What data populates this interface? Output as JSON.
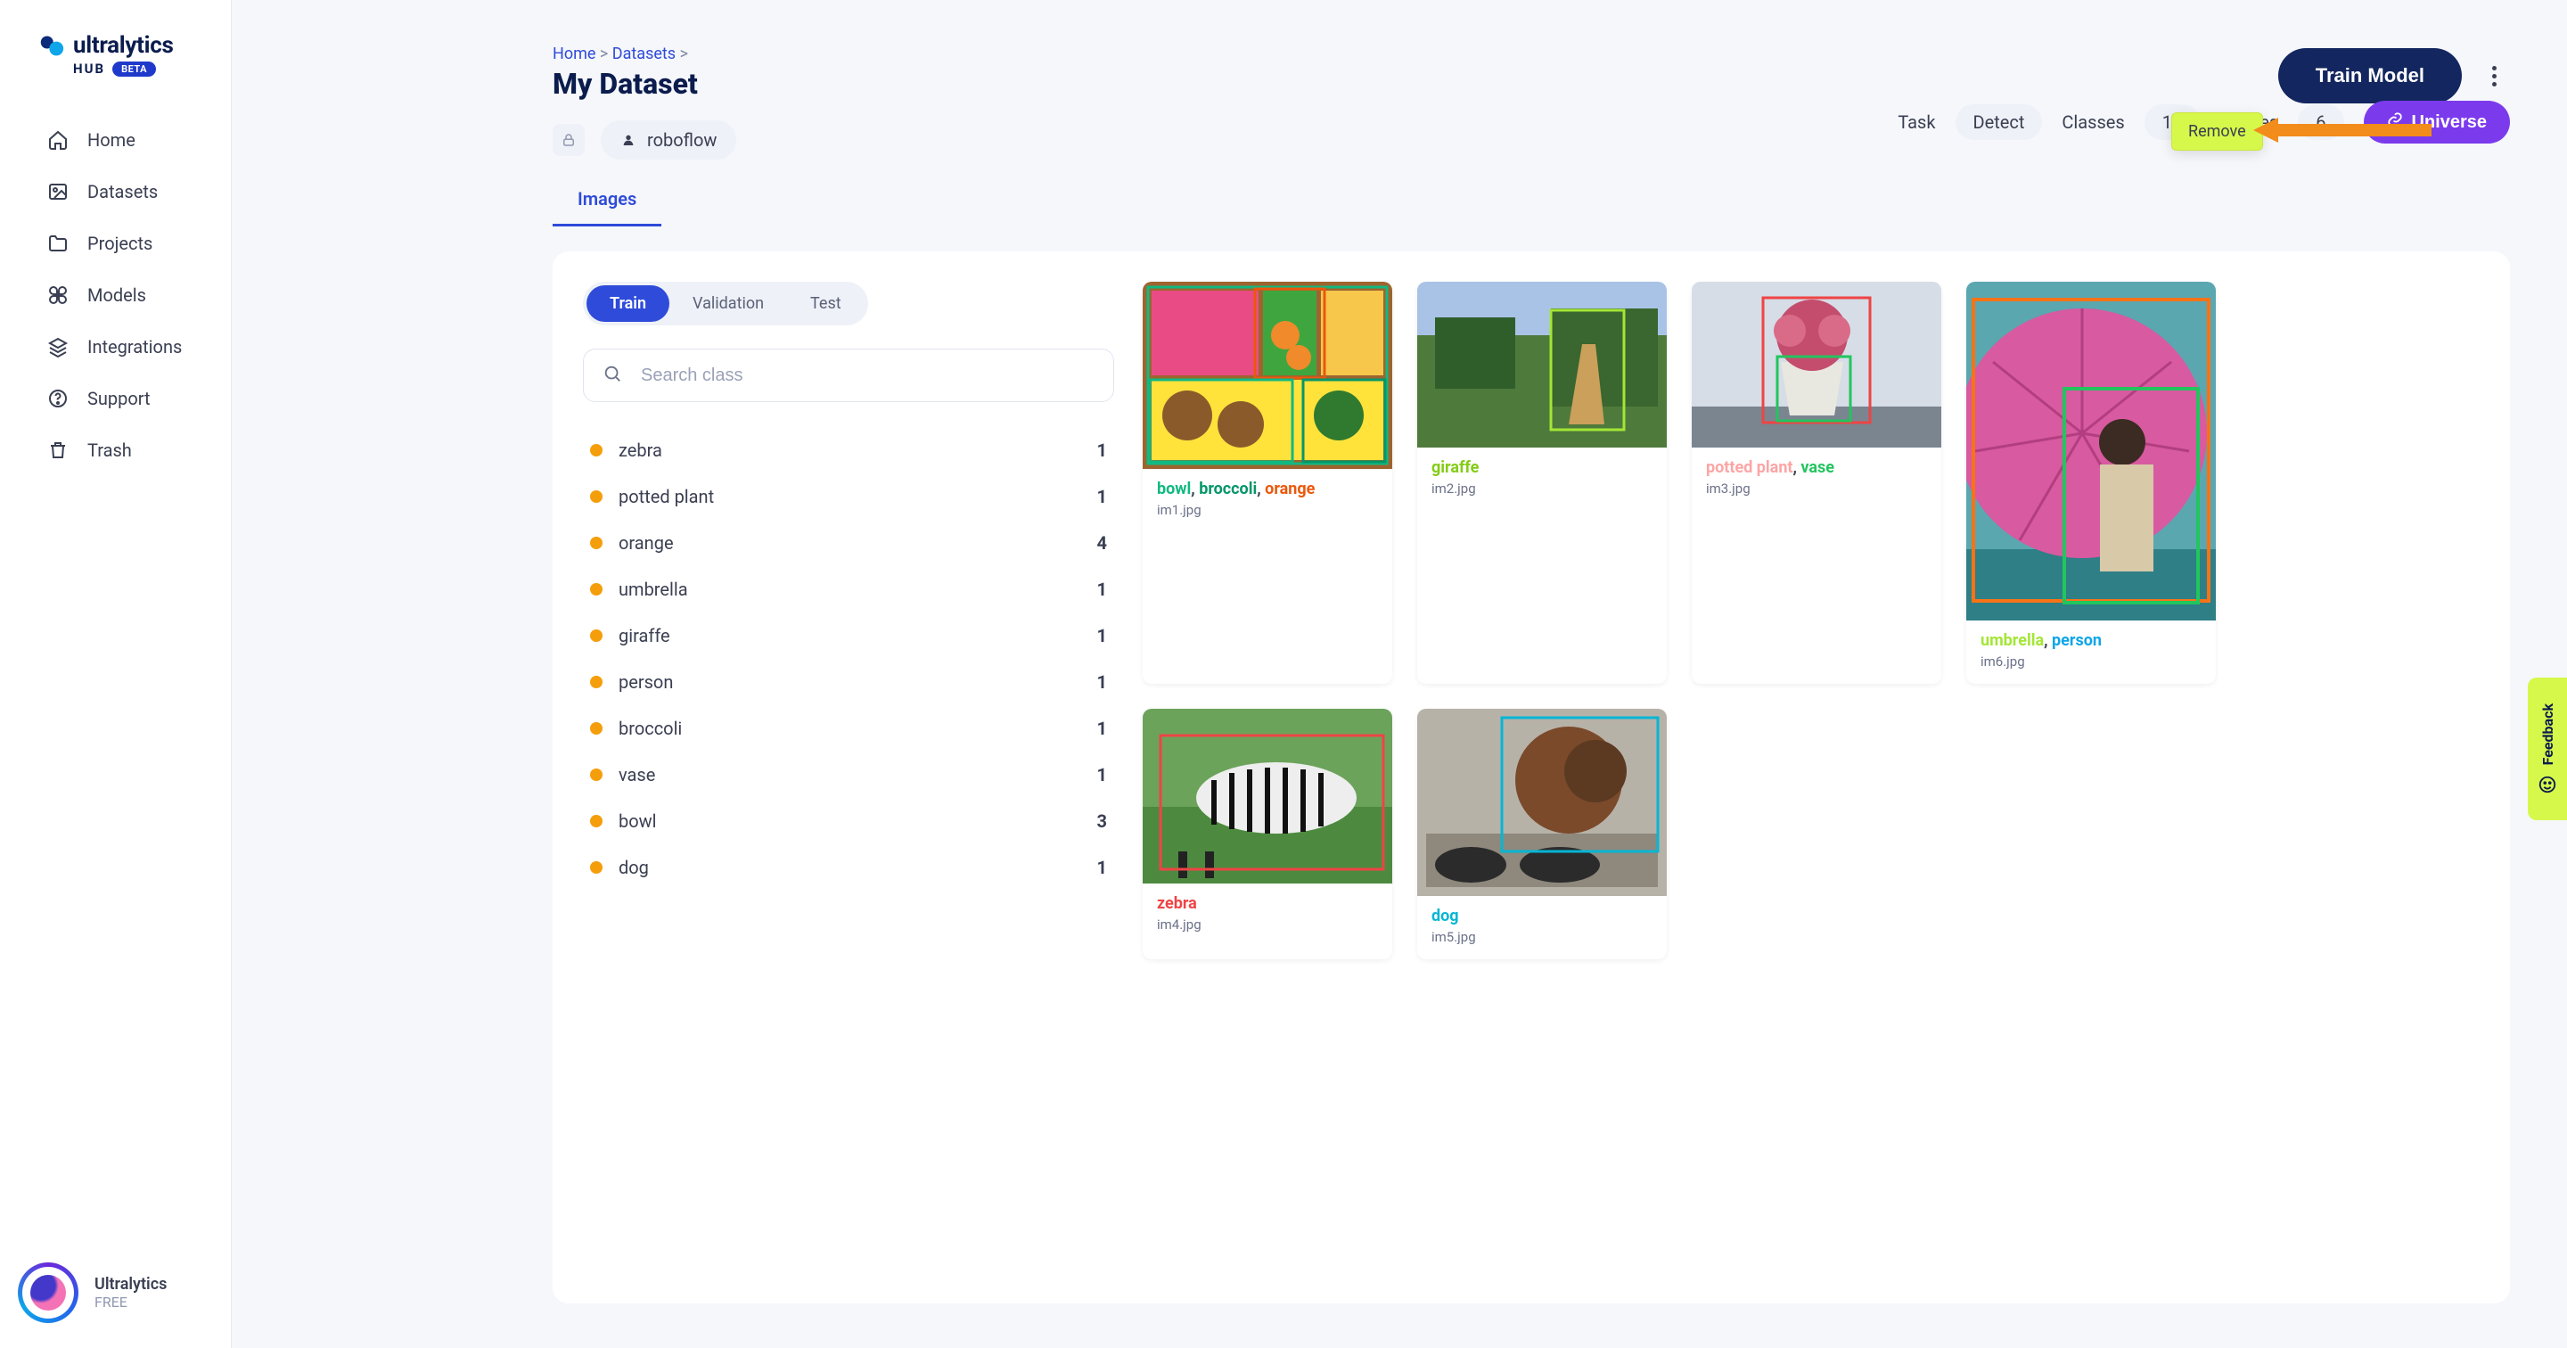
{
  "logo": {
    "brand": "ultralytics",
    "sub": "HUB",
    "beta": "BETA"
  },
  "sidebar": {
    "items": [
      {
        "label": "Home"
      },
      {
        "label": "Datasets"
      },
      {
        "label": "Projects"
      },
      {
        "label": "Models"
      },
      {
        "label": "Integrations"
      },
      {
        "label": "Support"
      },
      {
        "label": "Trash"
      }
    ],
    "footer": {
      "name": "Ultralytics",
      "plan": "FREE"
    }
  },
  "breadcrumbs": {
    "home": "Home",
    "datasets": "Datasets"
  },
  "page_title": "My Dataset",
  "train_button": "Train Model",
  "owner": "roboflow",
  "stats": {
    "task_label": "Task",
    "task_value": "Detect",
    "classes_label": "Classes",
    "classes_value": "10",
    "images_label": "Images",
    "images_value": "6",
    "universe_btn": "Universe"
  },
  "tab_images": "Images",
  "splits": {
    "train": "Train",
    "validation": "Validation",
    "test": "Test"
  },
  "search_placeholder": "Search class",
  "classes": [
    {
      "name": "zebra",
      "count": "1"
    },
    {
      "name": "potted plant",
      "count": "1"
    },
    {
      "name": "orange",
      "count": "4"
    },
    {
      "name": "umbrella",
      "count": "1"
    },
    {
      "name": "giraffe",
      "count": "1"
    },
    {
      "name": "person",
      "count": "1"
    },
    {
      "name": "broccoli",
      "count": "1"
    },
    {
      "name": "vase",
      "count": "1"
    },
    {
      "name": "bowl",
      "count": "3"
    },
    {
      "name": "dog",
      "count": "1"
    }
  ],
  "cards": {
    "im1": {
      "labels": [
        "bowl",
        "broccoli",
        "orange"
      ],
      "file": "im1.jpg"
    },
    "im2": {
      "labels": [
        "giraffe"
      ],
      "file": "im2.jpg"
    },
    "im3": {
      "labels": [
        "potted plant",
        "vase"
      ],
      "file": "im3.jpg"
    },
    "im4": {
      "labels": [
        "zebra"
      ],
      "file": "im4.jpg"
    },
    "im5": {
      "labels": [
        "dog"
      ],
      "file": "im5.jpg"
    },
    "im6": {
      "labels": [
        "umbrella",
        "person"
      ],
      "file": "im6.jpg"
    }
  },
  "popover": {
    "remove": "Remove"
  },
  "feedback": "Feedback"
}
